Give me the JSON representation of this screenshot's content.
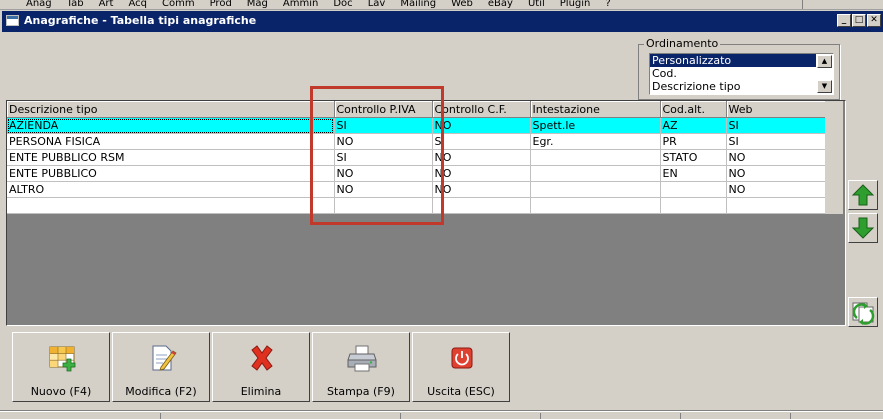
{
  "menubar": {
    "items": [
      "Anag",
      "Tab",
      "Art",
      "Acq",
      "Comm",
      "Prod",
      "Mag",
      "Ammin",
      "Doc",
      "Lav",
      "Mailing",
      "Web",
      "eBay",
      "Util",
      "Plugin",
      "?"
    ]
  },
  "window": {
    "title": "Anagrafiche - Tabella tipi anagrafiche",
    "minimize": "_",
    "maximize": "□",
    "close": "✕"
  },
  "ordinamento": {
    "label": "Ordinamento",
    "options": [
      "Personalizzato",
      "Cod.",
      "Descrizione tipo"
    ],
    "selected": "Personalizzato"
  },
  "grid": {
    "columns": [
      "Descrizione tipo",
      "Controllo P.IVA",
      "Controllo C.F.",
      "Intestazione",
      "Cod.alt.",
      "Web"
    ],
    "rows": [
      [
        "AZIENDA",
        "SI",
        "NO",
        "Spett.le",
        "AZ",
        "SI"
      ],
      [
        "PERSONA FISICA",
        "NO",
        "SI",
        "Egr.",
        "PR",
        "SI"
      ],
      [
        "ENTE PUBBLICO RSM",
        "SI",
        "NO",
        "",
        "STATO",
        "NO"
      ],
      [
        "ENTE PUBBLICO",
        "NO",
        "NO",
        "",
        "EN",
        "NO"
      ],
      [
        "ALTRO",
        "NO",
        "NO",
        "",
        "",
        "NO"
      ]
    ]
  },
  "toolbar": {
    "nuovo": "Nuovo (F4)",
    "modifica": "Modifica (F2)",
    "elimina": "Elimina",
    "stampa": "Stampa (F9)",
    "uscita": "Uscita (ESC)"
  },
  "colors": {
    "selection_row": "#00ffff",
    "title_bar": "#0a246a",
    "highlight_box": "#c0392b",
    "arrow_green": "#2e9e2e"
  }
}
